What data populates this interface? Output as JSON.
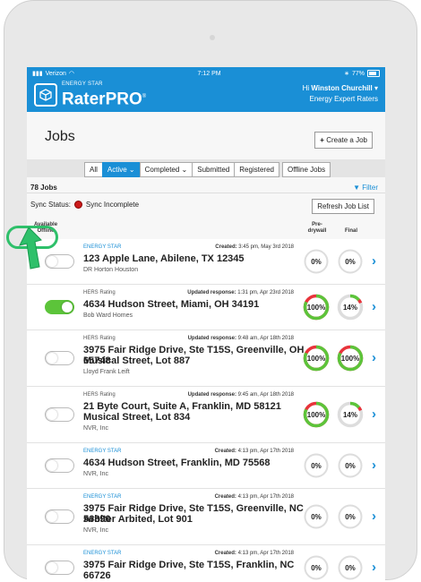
{
  "statusbar": {
    "carrier": "Verizon",
    "time": "7:12 PM",
    "battery": "77%"
  },
  "header": {
    "brand_top": "ENERGY STAR",
    "brand_main": "RaterPRO",
    "brand_mark": "®",
    "greeting": "Hi",
    "user_name": "Winston Churchill",
    "company": "Energy Expert Raters"
  },
  "page": {
    "title": "Jobs",
    "create_label": "Create a Job",
    "create_icon": "+"
  },
  "tabs": [
    {
      "label": "All",
      "active": false
    },
    {
      "label": "Active",
      "active": true,
      "caret": true
    },
    {
      "label": "Completed",
      "active": false,
      "caret": true
    },
    {
      "label": "Submitted",
      "active": false
    },
    {
      "label": "Registered",
      "active": false
    },
    {
      "label": "Offline Jobs",
      "active": false
    }
  ],
  "jobs_count": "78 Jobs",
  "filter_label": "Filter",
  "sync": {
    "label": "Sync Status:",
    "status": "Sync Incomplete"
  },
  "refresh_label": "Refresh Job List",
  "columns": {
    "offline": "Available Offline",
    "predrywall": "Pre-drywall",
    "final": "Final"
  },
  "colors": {
    "accent": "#1a8fd6",
    "green": "#5cc43a",
    "red": "#e8343b",
    "ring_grey": "#dddddd"
  },
  "jobs": [
    {
      "type": "ENERGY STAR",
      "meta_label": "Created:",
      "meta_value": "3:45 pm, May 3rd 2018",
      "address": [
        "123 Apple Lane, Abilene, TX 12345"
      ],
      "builder": "DR Horton Houston",
      "offline": false,
      "predrywall": {
        "text": "0%",
        "value": 0
      },
      "final": {
        "text": "0%",
        "value": 0
      }
    },
    {
      "type": "HERS Rating",
      "meta_label": "Updated response:",
      "meta_value": "1:31 pm, Apr 23rd 2018",
      "address": [
        "4634 Hudson Street, Miami, OH 34191"
      ],
      "builder": "Bob Ward Homes",
      "offline": true,
      "predrywall": {
        "text": "100%",
        "value": 100
      },
      "final": {
        "text": "14%",
        "value": 14
      }
    },
    {
      "type": "HERS Rating",
      "meta_label": "Updated response:",
      "meta_value": "9:48 am, Apr 18th 2018",
      "address": [
        "3975 Fair Ridge Drive, Ste T15S, Greenville, OH 65748",
        "Musical Street, Lot 887"
      ],
      "builder": "Lloyd Frank Leift",
      "offline": false,
      "predrywall": {
        "text": "100%",
        "value": 100
      },
      "final": {
        "text": "100%",
        "value": 100
      }
    },
    {
      "type": "HERS Rating",
      "meta_label": "Updated response:",
      "meta_value": "9:45 am, Apr 18th 2018",
      "address": [
        "21 Byte Court, Suite A, Franklin, MD 58121",
        "Musical Street, Lot 834"
      ],
      "builder": "NVR, Inc",
      "offline": false,
      "predrywall": {
        "text": "100%",
        "value": 100
      },
      "final": {
        "text": "14%",
        "value": 14
      }
    },
    {
      "type": "ENERGY STAR",
      "meta_label": "Created:",
      "meta_value": "4:13 pm, Apr 17th 2018",
      "address": [
        "4634 Hudson Street, Franklin, MD 75568"
      ],
      "builder": "NVR, Inc",
      "offline": false,
      "predrywall": {
        "text": "0%",
        "value": 0
      },
      "final": {
        "text": "0%",
        "value": 0
      }
    },
    {
      "type": "ENERGY STAR",
      "meta_label": "Created:",
      "meta_value": "4:13 pm, Apr 17th 2018",
      "address": [
        "3975 Fair Ridge Drive, Ste T15S, Greenville, NC 56890",
        "Arbiter Arbited, Lot 901"
      ],
      "builder": "NVR, Inc",
      "offline": false,
      "predrywall": {
        "text": "0%",
        "value": 0
      },
      "final": {
        "text": "0%",
        "value": 0
      }
    },
    {
      "type": "ENERGY STAR",
      "meta_label": "Created:",
      "meta_value": "4:13 pm, Apr 17th 2018",
      "address": [
        "3975 Fair Ridge Drive, Ste T15S, Franklin, NC 66726"
      ],
      "builder": "",
      "offline": false,
      "predrywall": {
        "text": "0%",
        "value": 0
      },
      "final": {
        "text": "0%",
        "value": 0
      }
    }
  ]
}
